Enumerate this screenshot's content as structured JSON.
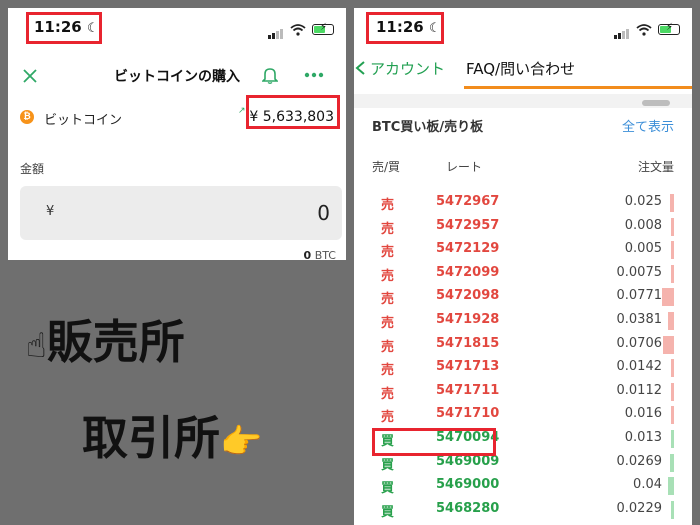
{
  "left": {
    "time": "11:26",
    "moon_glyph": "☾",
    "title": "ビットコインの購入",
    "coin_name": "ビットコイン",
    "coin_symbol": "₿",
    "price": "¥ 5,633,803",
    "amount_label": "金額",
    "yen_symbol": "¥",
    "amount_value": "0",
    "btc_balance_value": "0",
    "btc_balance_unit": "BTC"
  },
  "captions": {
    "hand_up": "☝",
    "market": "販売所",
    "exchange": "取引所",
    "hand_point": "👉"
  },
  "right": {
    "time": "11:26",
    "moon_glyph": "☾",
    "back_label": "アカウント",
    "faq_label": "FAQ/問い合わせ",
    "book_title": "BTC買い板/売り板",
    "view_all": "全て表示",
    "col_side": "売/買",
    "col_rate": "レート",
    "col_qty": "注文量",
    "rows": [
      {
        "side": "売",
        "rate": "5472967",
        "qty": "0.025"
      },
      {
        "side": "売",
        "rate": "5472957",
        "qty": "0.008"
      },
      {
        "side": "売",
        "rate": "5472129",
        "qty": "0.005"
      },
      {
        "side": "売",
        "rate": "5472099",
        "qty": "0.0075"
      },
      {
        "side": "売",
        "rate": "5472098",
        "qty": "0.0771"
      },
      {
        "side": "売",
        "rate": "5471928",
        "qty": "0.0381"
      },
      {
        "side": "売",
        "rate": "5471815",
        "qty": "0.0706"
      },
      {
        "side": "売",
        "rate": "5471713",
        "qty": "0.0142"
      },
      {
        "side": "売",
        "rate": "5471711",
        "qty": "0.0112"
      },
      {
        "side": "売",
        "rate": "5471710",
        "qty": "0.016"
      },
      {
        "side": "買",
        "rate": "5470094",
        "qty": "0.013"
      },
      {
        "side": "買",
        "rate": "5469009",
        "qty": "0.0269"
      },
      {
        "side": "買",
        "rate": "5469000",
        "qty": "0.04"
      },
      {
        "side": "買",
        "rate": "5468280",
        "qty": "0.0229"
      }
    ]
  },
  "colors": {
    "sell": "#e2473f",
    "buy": "#27a04b",
    "sell_depth": "#f5b3ad",
    "buy_depth": "#a8e0b6",
    "accent_green": "#22a052",
    "highlight": "#e8242f"
  }
}
